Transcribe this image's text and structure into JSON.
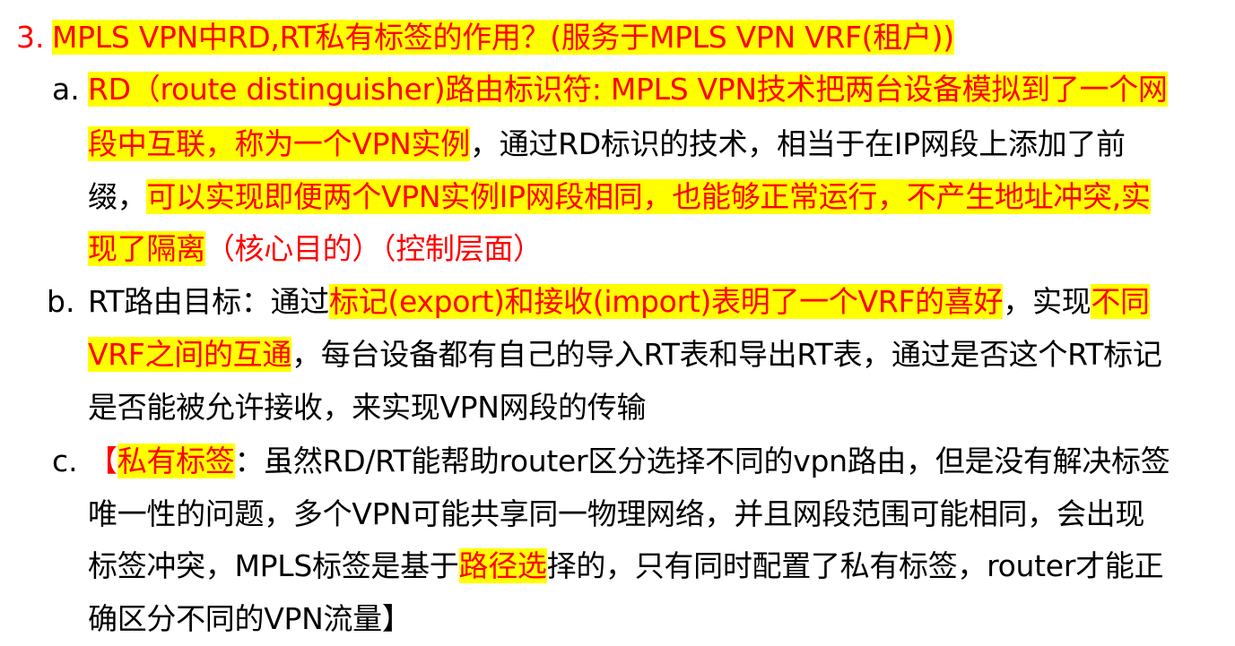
{
  "item3": {
    "marker": "3.",
    "title": "MPLS VPN中RD,RT私有标签的作用？(服务于MPLS VPN VRF(租户))"
  },
  "item_a": {
    "marker": "a.",
    "lines": [
      [
        "RD（route distinguisher)路由标识符: MPLS VPN技术把两台设备模拟到了一个网"
      ],
      [
        "段中互联，称为一个VPN实例",
        "，通过RD标识的技术，相当于在IP网段上添加了前"
      ],
      [
        "缀，",
        "可以实现即便两个VPN实例IP网段相同，也能够正常运行，不产生地址冲突,实"
      ],
      [
        "现了隔离",
        "（核心目的）（控制层面）"
      ]
    ]
  },
  "item_b": {
    "marker": "b.",
    "lines": [
      [
        "RT路由目标：通过",
        "标记(export)和接收(import)表明了一个VRF的喜好",
        "，实现",
        "不同"
      ],
      [
        "VRF之间的互通",
        "，每台设备都有自己的导入RT表和导出RT表，通过是否这个RT标记"
      ],
      [
        "是否能被允许接收，来实现VPN网段的传输"
      ]
    ]
  },
  "item_c": {
    "marker": "c.",
    "lines": [
      [
        "【",
        "私有标签",
        "：虽然RD/RT能帮助router区分选择不同的vpn路由，但是没有解决标签"
      ],
      [
        "唯一性的问题，多个VPN可能共享同一物理网络，并且网段范围可能相同，会出现"
      ],
      [
        "标签冲突，MPLS标签是基于",
        "路径选",
        "择的，只有同时配置了私有标签，router才能正"
      ],
      [
        "确区分不同的VPN流量】"
      ]
    ]
  },
  "colors": {
    "highlight": "#ffff00",
    "emphasis_text": "#ff0000",
    "body_text": "#000000"
  }
}
